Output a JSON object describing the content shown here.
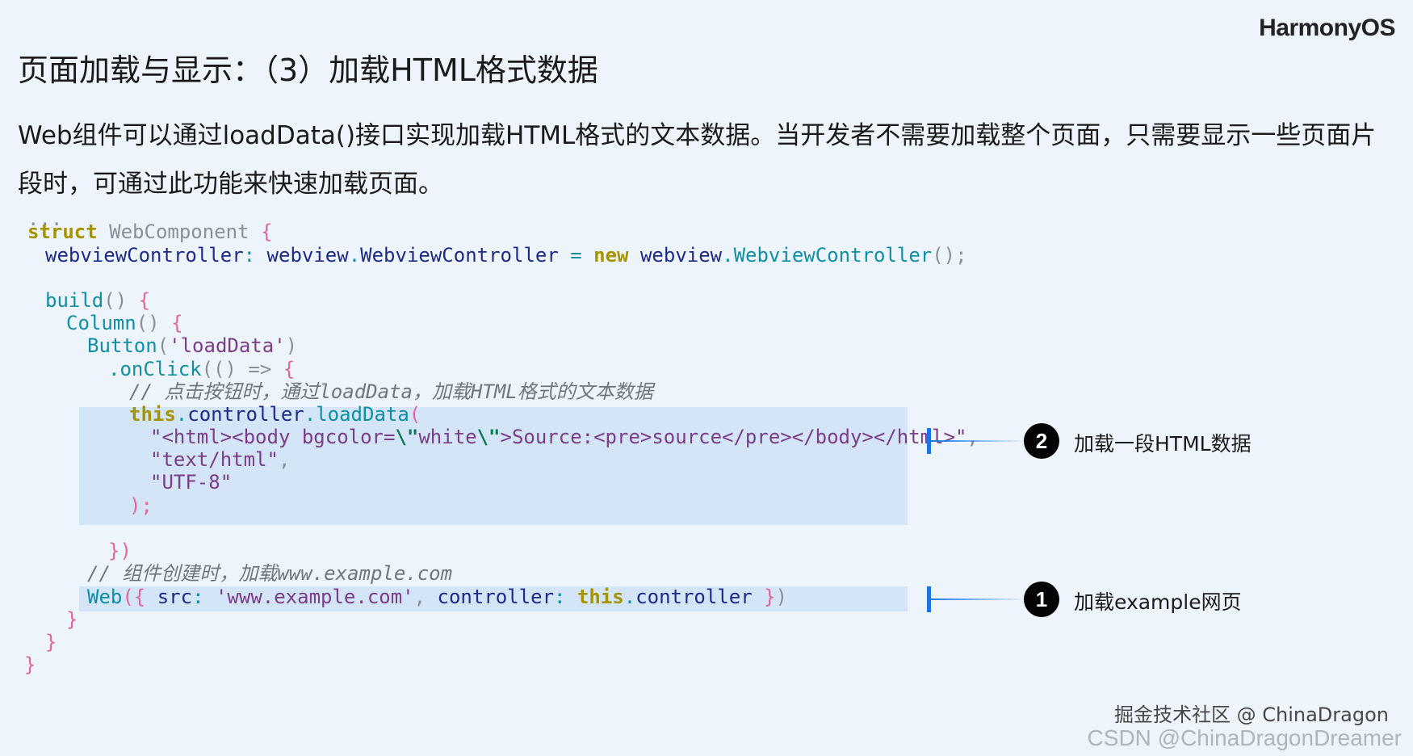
{
  "header": {
    "logo": "HarmonyOS",
    "title": "页面加载与显示：（3）加载HTML格式数据"
  },
  "description": "Web组件可以通过loadData()接口实现加载HTML格式的文本数据。当开发者不需要加载整个页面，只需要显示一些页面片段时，可通过此功能来快速加载页面。",
  "code": {
    "ellipsis": "...",
    "l_struct_kw": "struct",
    "l_struct_name": "WebComponent",
    "brace_open": "{",
    "l_ctrl_field": "webviewController",
    "colon": ":",
    "ns_webview": "webview",
    "dot": ".",
    "cls_ctrl": "WebviewController",
    "eq": "=",
    "kw_new": "new",
    "call_close_semi": "();",
    "build": "build",
    "parens": "()",
    "column": "Column",
    "button": "Button",
    "button_arg": "'loadData'",
    "open_paren": "(",
    "close_paren": ")",
    "onclick": ".onClick",
    "arrow": "(() =>",
    "comment1": "// 点击按钮时，通过loadData，加载HTML格式的文本数据",
    "kw_this": "this",
    "controller": "controller",
    "loaddata": "loadData",
    "html_str_a": "\"<html><body bgcolor=",
    "esc_a": "\\\"",
    "html_str_b": "white",
    "html_str_c": ">Source:<pre>source</pre></body></html>\"",
    "comma": ",",
    "mime": "\"text/html\"",
    "encoding": "\"UTF-8\"",
    "close_semi": ");",
    "close_brace_paren": "})",
    "close_brace": "}",
    "comment2": "// 组件创建时，加载www.example.com",
    "web": "Web",
    "src_key": "src",
    "src_val": "'www.example.com'",
    "ctrl_key": "controller",
    "close_obj": "}",
    "web_open": "({"
  },
  "callouts": [
    {
      "number": "2",
      "label": "加载一段HTML数据"
    },
    {
      "number": "1",
      "label": "加载example网页"
    }
  ],
  "watermark": {
    "site": "掘金技术社区 @ ChinaDragon",
    "csdn": "CSDN @ChinaDragonDreamer"
  },
  "colors": {
    "accent": "#1a73e8",
    "highlight": "#d3e5f6",
    "background": "#eef4fb"
  }
}
